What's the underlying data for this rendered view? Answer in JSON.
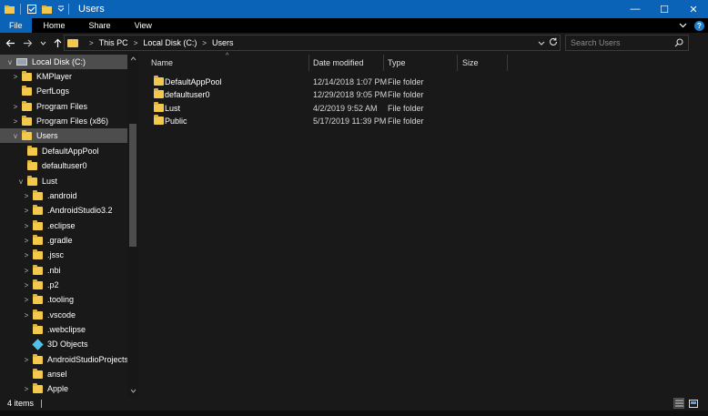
{
  "window": {
    "title": "Users",
    "controls": {
      "minimize": "—",
      "maximize": "☐",
      "close": "✕"
    }
  },
  "ribbon": {
    "tabs": [
      "File",
      "Home",
      "Share",
      "View"
    ],
    "help": "?"
  },
  "address": {
    "crumbs": [
      "This PC",
      "Local Disk (C:)",
      "Users"
    ],
    "search_placeholder": "Search Users"
  },
  "sidebar": {
    "items": [
      {
        "label": "Local Disk (C:)",
        "icon": "drive-icon",
        "chevron": "v"
      },
      {
        "label": "KMPlayer",
        "icon": "folder-icon",
        "chevron": ">"
      },
      {
        "label": "PerfLogs",
        "icon": "folder-icon",
        "chevron": ""
      },
      {
        "label": "Program Files",
        "icon": "folder-icon",
        "chevron": ">"
      },
      {
        "label": "Program Files (x86)",
        "icon": "folder-icon",
        "chevron": ">"
      },
      {
        "label": "Users",
        "icon": "folder-icon",
        "chevron": "v",
        "selected": true
      },
      {
        "label": "DefaultAppPool",
        "icon": "folder-icon",
        "chevron": ""
      },
      {
        "label": "defaultuser0",
        "icon": "folder-icon",
        "chevron": ""
      },
      {
        "label": "Lust",
        "icon": "folder-icon",
        "chevron": "v"
      },
      {
        "label": ".android",
        "icon": "folder-icon",
        "chevron": ">"
      },
      {
        "label": ".AndroidStudio3.2",
        "icon": "folder-icon",
        "chevron": ">"
      },
      {
        "label": ".eclipse",
        "icon": "folder-icon",
        "chevron": ">"
      },
      {
        "label": ".gradle",
        "icon": "folder-icon",
        "chevron": ">"
      },
      {
        "label": ".jssc",
        "icon": "folder-icon",
        "chevron": ">"
      },
      {
        "label": ".nbi",
        "icon": "folder-icon",
        "chevron": ">"
      },
      {
        "label": ".p2",
        "icon": "folder-icon",
        "chevron": ">"
      },
      {
        "label": ".tooling",
        "icon": "folder-icon",
        "chevron": ">"
      },
      {
        "label": ".vscode",
        "icon": "folder-icon",
        "chevron": ">"
      },
      {
        "label": ".webclipse",
        "icon": "folder-icon",
        "chevron": ""
      },
      {
        "label": "3D Objects",
        "icon": "3d-objects-icon",
        "chevron": ""
      },
      {
        "label": "AndroidStudioProjects",
        "icon": "folder-icon",
        "chevron": ">"
      },
      {
        "label": "ansel",
        "icon": "folder-icon",
        "chevron": ""
      },
      {
        "label": "Apple",
        "icon": "folder-icon",
        "chevron": ">"
      }
    ]
  },
  "columns": [
    "Name",
    "Date modified",
    "Type",
    "Size"
  ],
  "files": [
    {
      "name": "DefaultAppPool",
      "date": "12/14/2018 1:07 PM",
      "type": "File folder",
      "size": ""
    },
    {
      "name": "defaultuser0",
      "date": "12/29/2018 9:05 PM",
      "type": "File folder",
      "size": ""
    },
    {
      "name": "Lust",
      "date": "4/2/2019 9:52 AM",
      "type": "File folder",
      "size": ""
    },
    {
      "name": "Public",
      "date": "5/17/2019 11:39 PM",
      "type": "File folder",
      "size": ""
    }
  ],
  "status": {
    "item_count": "4 items"
  },
  "colors": {
    "accent": "#0a63b6",
    "background": "#191919",
    "selected": "#4d4d4d",
    "folder": "#f2c94c"
  }
}
